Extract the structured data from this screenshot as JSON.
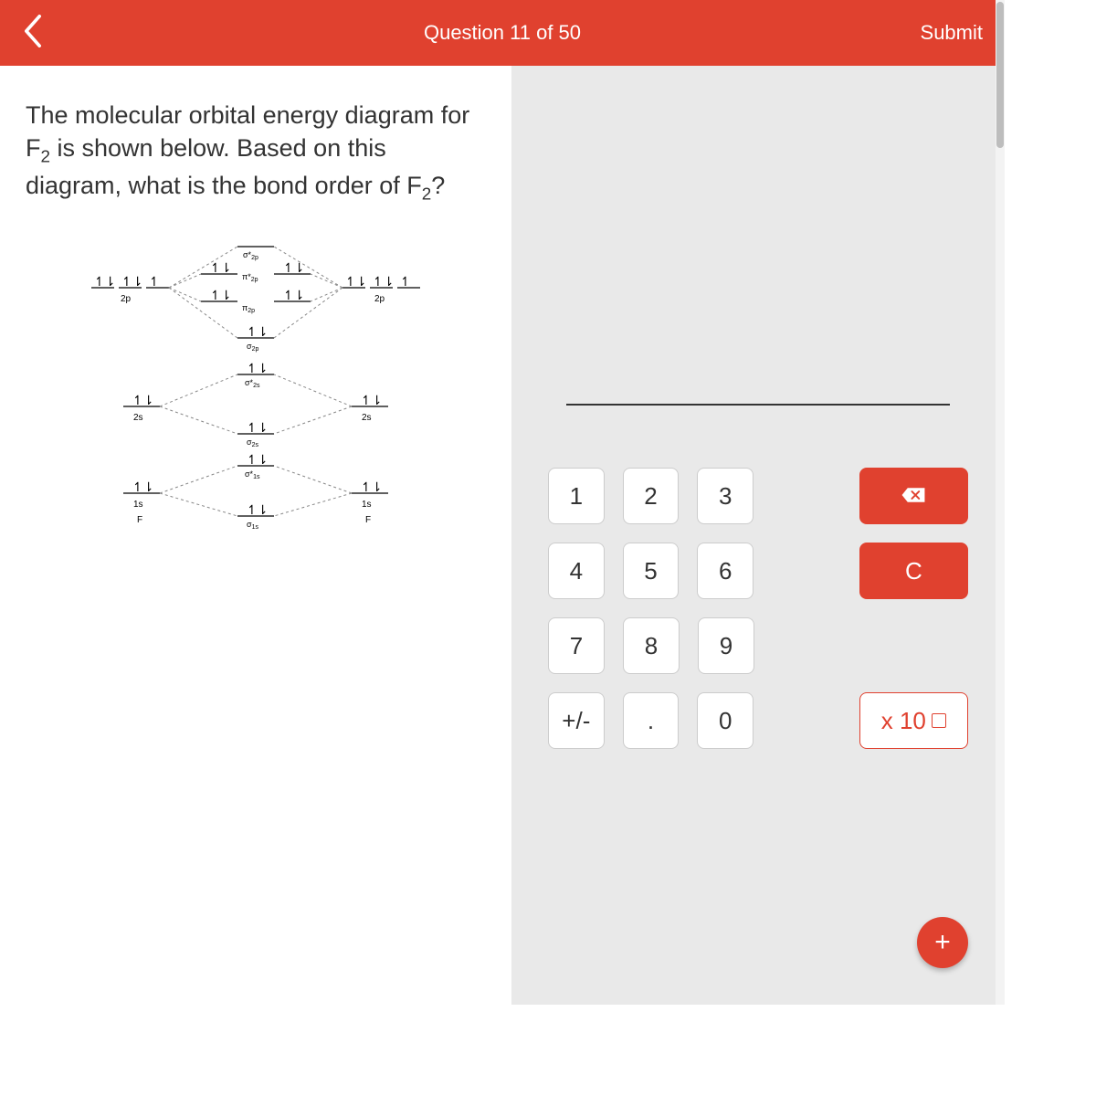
{
  "header": {
    "title": "Question 11 of 50",
    "submit": "Submit"
  },
  "question": {
    "html": "The molecular orbital energy diagram for F<sub>2</sub> is shown below. Based on this diagram, what is the bond order of F<sub>2</sub>?"
  },
  "mo_diagram": {
    "atom_label": "F",
    "atomic_orbitals_left": [
      "2p",
      "2s",
      "1s"
    ],
    "atomic_orbitals_right": [
      "2p",
      "2s",
      "1s"
    ],
    "mo_labels_top_to_bottom": [
      "σ*2p",
      "π*2p",
      "π2p",
      "σ2p",
      "σ*2s",
      "σ2s",
      "σ*1s",
      "σ1s"
    ],
    "electron_pair_glyph": "↿⇂"
  },
  "keypad": {
    "keys": {
      "k1": "1",
      "k2": "2",
      "k3": "3",
      "k4": "4",
      "k5": "5",
      "k6": "6",
      "k7": "7",
      "k8": "8",
      "k9": "9",
      "plusminus": "+/-",
      "dot": ".",
      "k0": "0",
      "clear": "C",
      "sci": "x 10"
    }
  },
  "fab": {
    "label": "+"
  }
}
